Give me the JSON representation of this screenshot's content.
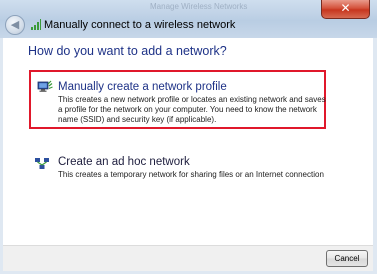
{
  "window": {
    "title": "Manually connect to a wireless network",
    "background_title": "Manage Wireless Networks",
    "close_glyph": "✕",
    "back_glyph": "◀"
  },
  "main": {
    "heading": "How do you want to add a network?",
    "options": [
      {
        "title": "Manually create a network profile",
        "description": "This creates a new network profile or locates an existing network and saves a profile for the network on your computer. You need to know the network name (SSID) and security key (if applicable).",
        "icon": "network-profile-icon",
        "highlighted": true
      },
      {
        "title": "Create an ad hoc network",
        "description": "This creates a temporary network for sharing files or an Internet connection",
        "icon": "ad-hoc-network-icon",
        "highlighted": false
      }
    ]
  },
  "footer": {
    "cancel_label": "Cancel"
  },
  "colors": {
    "heading": "#1e3287",
    "highlight_border": "#e0182b",
    "close_button": "#c7361f"
  }
}
